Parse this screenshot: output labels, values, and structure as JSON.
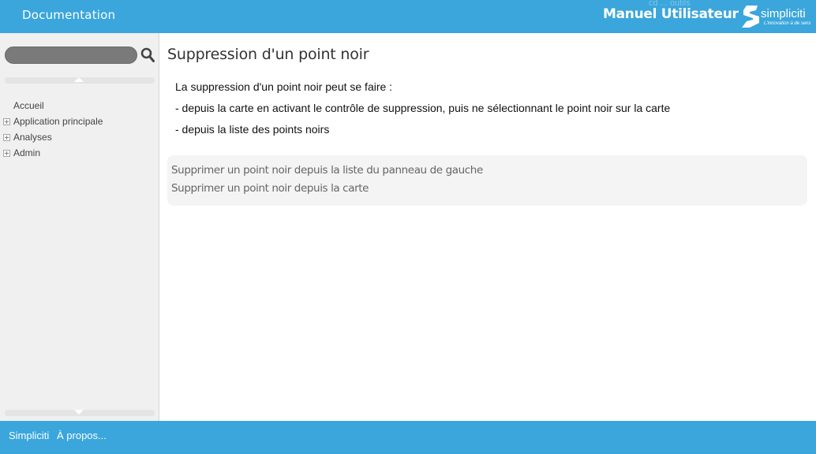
{
  "header": {
    "doc_title": "Documentation",
    "manual_title": "Manuel Utilisateur",
    "ghost_text": "cd ... outils",
    "logo": {
      "name": "simpliciti",
      "tagline": "L'innovation à de sens"
    }
  },
  "sidebar": {
    "search": {
      "value": "",
      "placeholder": ""
    },
    "tree": [
      {
        "label": "Accueil",
        "expandable": false
      },
      {
        "label": "Application principale",
        "expandable": true
      },
      {
        "label": "Analyses",
        "expandable": true
      },
      {
        "label": "Admin",
        "expandable": true
      }
    ]
  },
  "main": {
    "title": "Suppression d'un point noir",
    "paragraphs": [
      "La suppression d'un point noir peut se faire :",
      "- depuis la carte en activant le contrôle de suppression, puis ne sélectionnant le point noir sur la carte",
      "- depuis la liste des points noirs"
    ],
    "links": [
      "Supprimer un point noir depuis la liste du panneau de gauche",
      "Supprimer un point noir depuis la carte"
    ]
  },
  "footer": {
    "links": [
      "Simpliciti",
      "À propos..."
    ]
  },
  "colors": {
    "accent": "#3aa6dc",
    "sidebar_bg": "#f0f0f0",
    "search_bg": "#7a7a7a"
  }
}
